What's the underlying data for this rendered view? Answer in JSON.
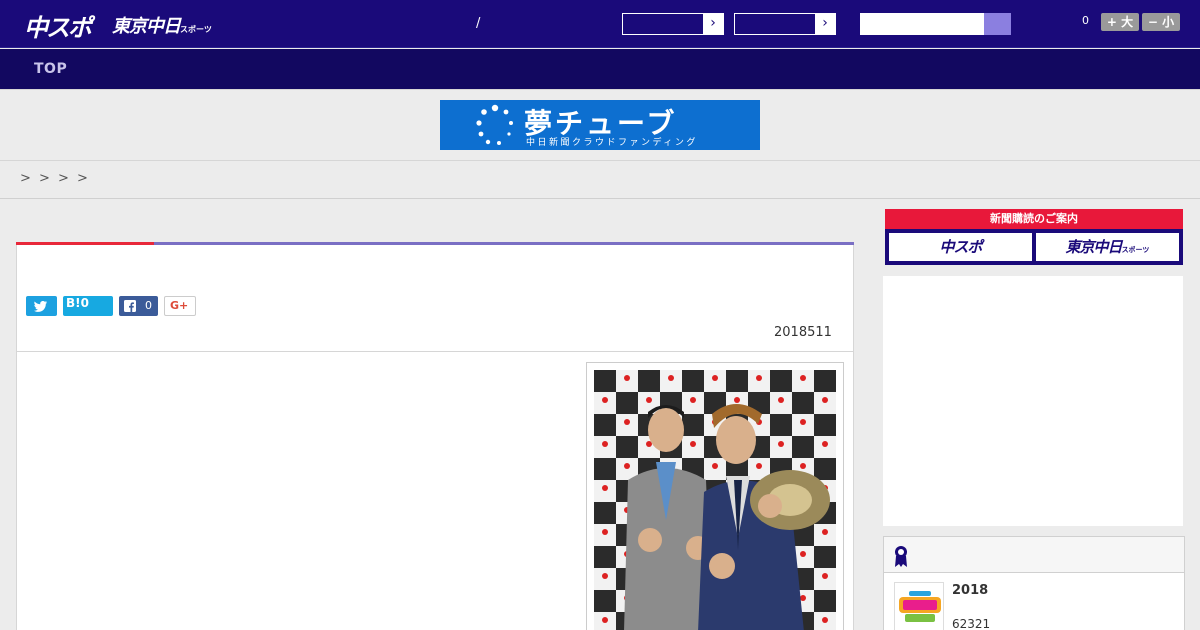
{
  "header": {
    "logo_primary": "中スポ",
    "logo_secondary": "東京中日",
    "logo_secondary_small": "スポーツ",
    "nav_separator": "/",
    "select1_arrow": "›",
    "select2_arrow": "›",
    "search_placeholder": "",
    "font_size_count": "0",
    "font_increase_label": "+ 大",
    "font_decrease_label": "− 小"
  },
  "nav": {
    "items": [
      {
        "label": "TOP"
      }
    ]
  },
  "banner": {
    "title": "夢チューブ",
    "subtitle": "中日新聞クラウドファンディング"
  },
  "breadcrumb": {
    "separators": [
      ">",
      ">",
      ">",
      ">"
    ]
  },
  "article": {
    "share": {
      "twitter_icon": "twitter-bird-icon",
      "hatena_label": "B!0",
      "facebook_count": "0",
      "gplus_label": "G+"
    },
    "date": "2018511"
  },
  "sidebar": {
    "subscribe_banner": {
      "title": "新聞購読のご案内",
      "left_label": "中スポ",
      "right_label": "東京中日",
      "right_label_small": "スポーツ"
    },
    "ranking": {
      "items": [
        {
          "title": "2018",
          "meta": "62321"
        }
      ]
    }
  },
  "colors": {
    "header_bg": "#1a0a7a",
    "nav_bg": "#120860",
    "accent_red": "#e8283a",
    "accent_purple": "#7a6fc4",
    "banner_blue": "#0d6fd0"
  }
}
